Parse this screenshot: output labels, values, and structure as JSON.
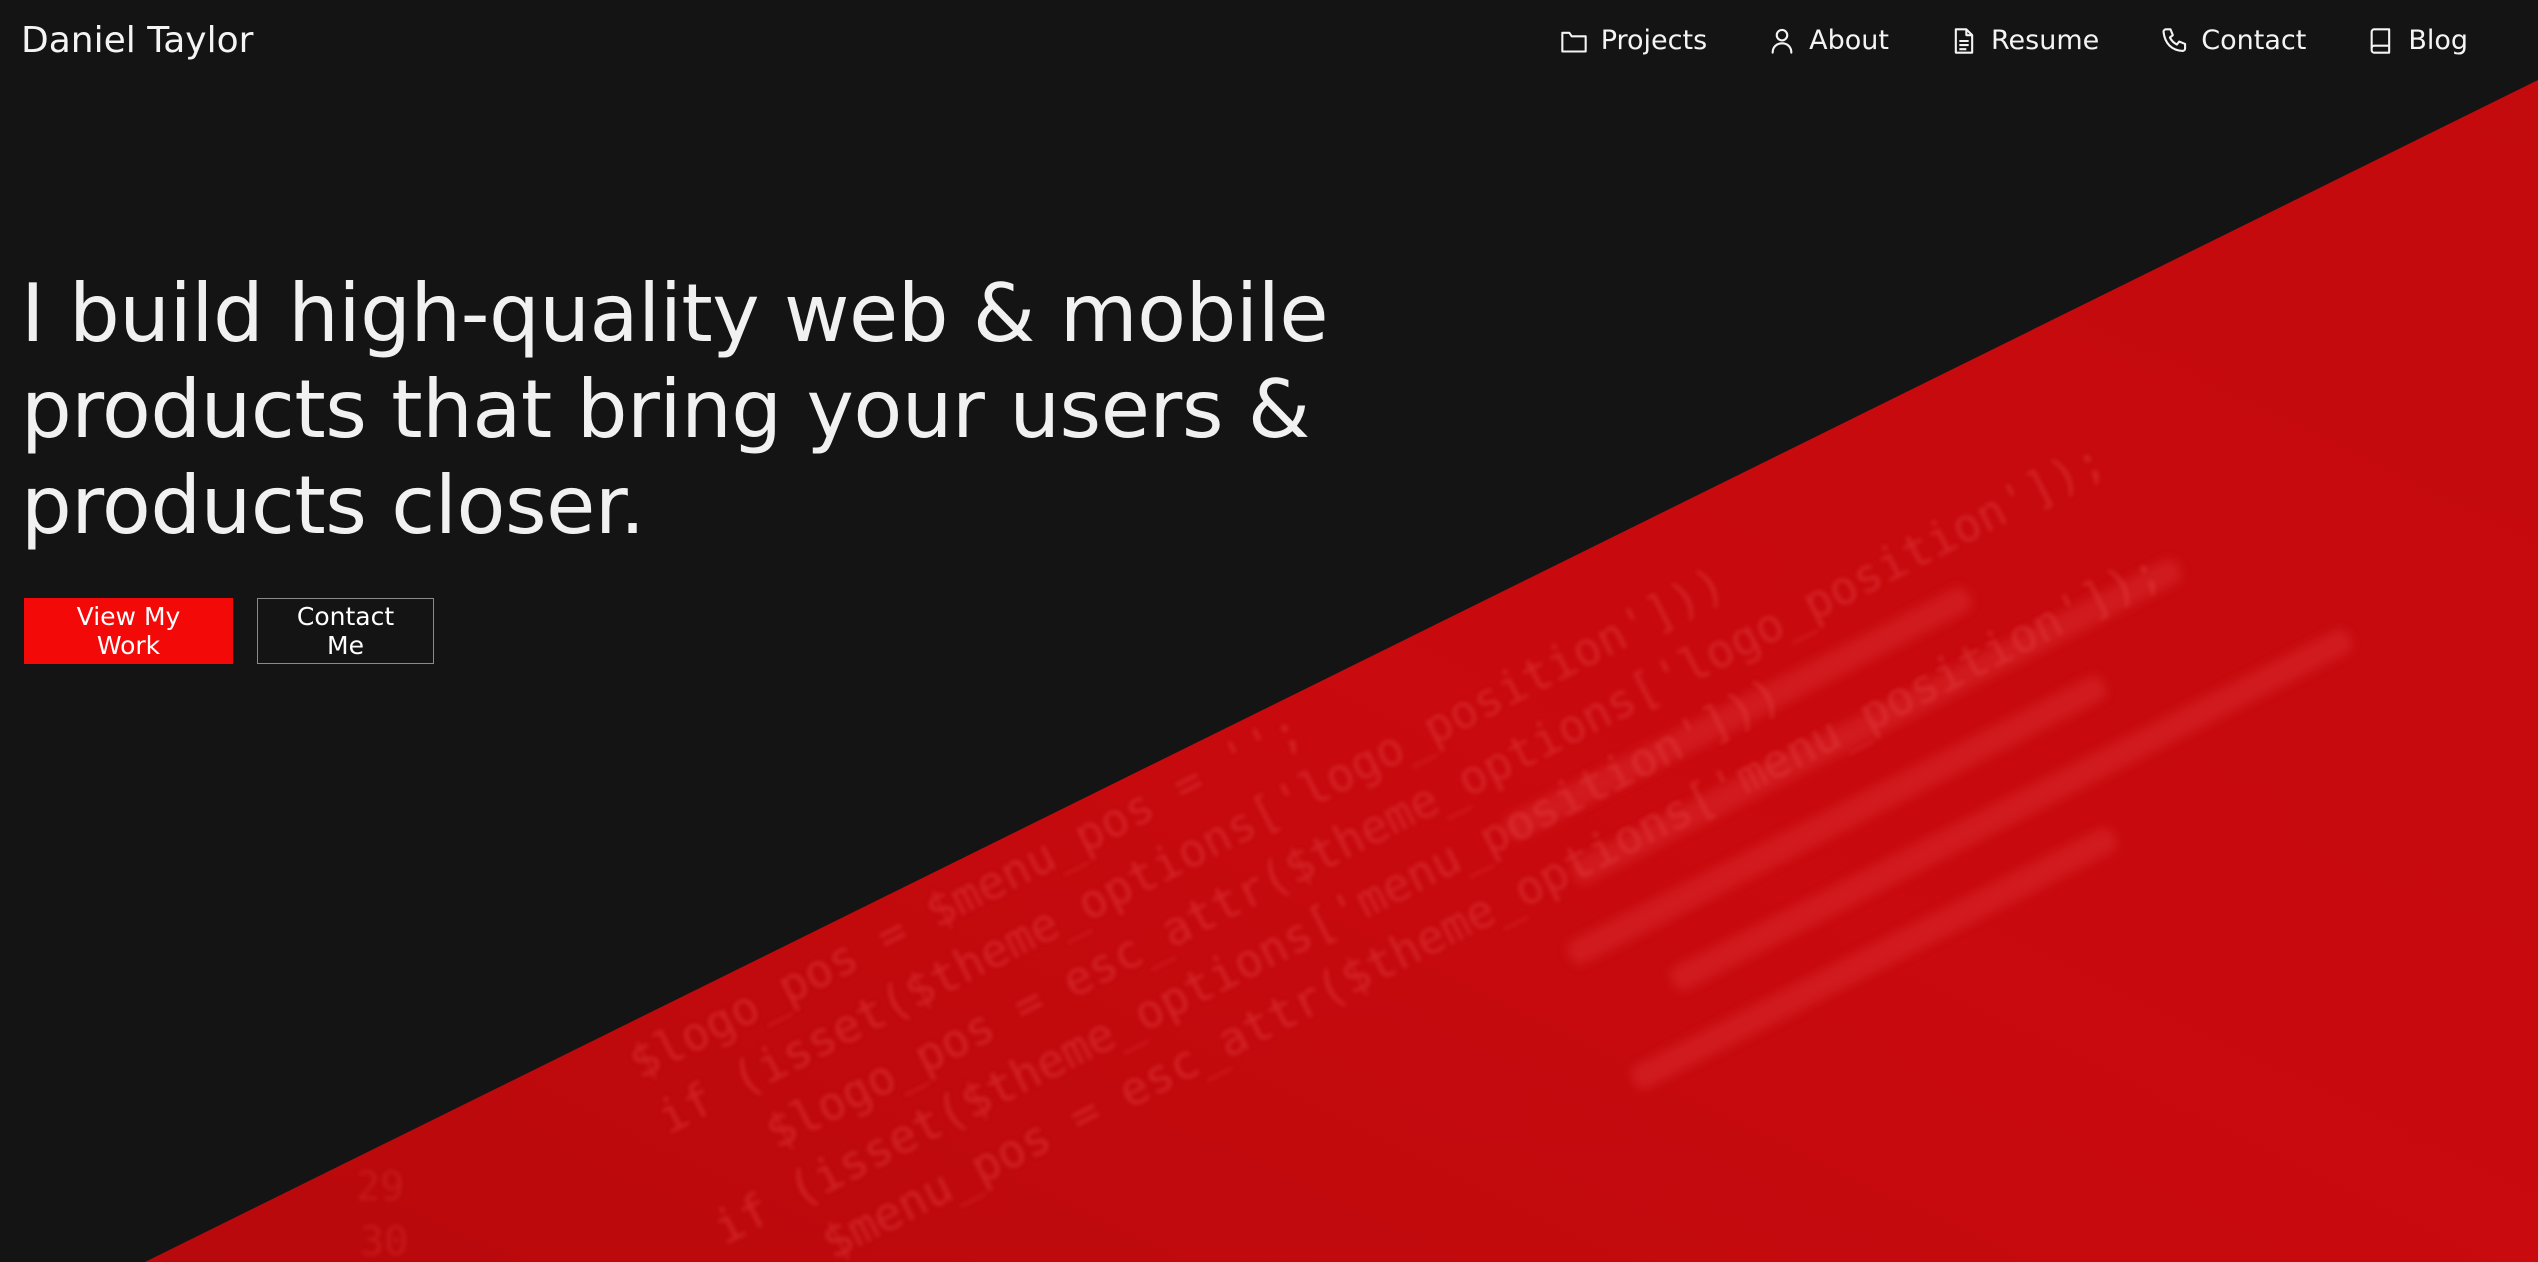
{
  "brand": {
    "name": "Daniel Taylor"
  },
  "nav": {
    "items": [
      {
        "label": "Projects",
        "icon": "folder-icon"
      },
      {
        "label": "About",
        "icon": "user-icon"
      },
      {
        "label": "Resume",
        "icon": "document-icon"
      },
      {
        "label": "Contact",
        "icon": "phone-icon"
      },
      {
        "label": "Blog",
        "icon": "book-icon"
      }
    ]
  },
  "hero": {
    "headline_lines": [
      "I build high-quality web & mobile",
      "products that bring your users &",
      "products closer."
    ],
    "primary_cta": "View My Work",
    "secondary_cta": "Contact Me"
  },
  "background_code": {
    "lines": [
      "$logo_pos = $menu_pos = '';",
      "if (isset($theme_options['logo_position']))",
      "$logo_pos = esc_attr($theme_options['logo_position']);",
      "if (isset($theme_options['menu_position']))",
      "$menu_pos = esc_attr($theme_options['menu_position']);",
      "29",
      "30"
    ]
  },
  "colors": {
    "background": "#141415",
    "accent_red": "#c80a0d",
    "button_red": "#f40909",
    "text": "#f2f2f2"
  }
}
